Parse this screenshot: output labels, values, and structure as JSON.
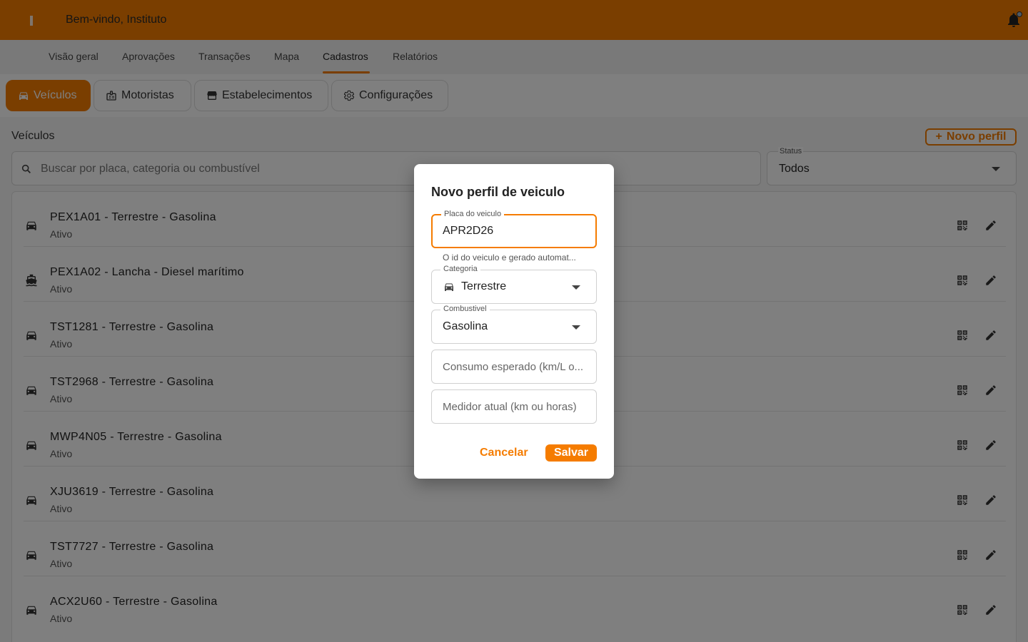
{
  "header": {
    "welcome": "Bem-vindo, Instituto",
    "menu_icon": "menu-icon",
    "notification_icon": "bell-icon"
  },
  "nav": {
    "tabs": [
      "Visão geral",
      "Aprovações",
      "Transações",
      "Mapa",
      "Cadastros",
      "Relatórios"
    ],
    "active": "Cadastros"
  },
  "chips": [
    {
      "label": "Veículos",
      "icon": "car-icon",
      "active": true
    },
    {
      "label": "Motoristas",
      "icon": "id-badge-icon",
      "active": false
    },
    {
      "label": "Estabelecimentos",
      "icon": "store-icon",
      "active": false
    },
    {
      "label": "Configurações",
      "icon": "gear-icon",
      "active": false
    }
  ],
  "section": {
    "title": "Veículos",
    "new_button": "Novo perfil"
  },
  "search": {
    "placeholder": "Buscar por placa, categoria ou combustível"
  },
  "status_filter": {
    "label": "Status",
    "value": "Todos"
  },
  "vehicles": [
    {
      "title": "PEX1A01 - Terrestre - Gasolina",
      "status": "Ativo",
      "icon": "car-icon"
    },
    {
      "title": "PEX1A02 - Lancha - Diesel marítimo",
      "status": "Ativo",
      "icon": "boat-icon"
    },
    {
      "title": "TST1281 - Terrestre - Gasolina",
      "status": "Ativo",
      "icon": "car-icon"
    },
    {
      "title": "TST2968 - Terrestre - Gasolina",
      "status": "Ativo",
      "icon": "car-icon"
    },
    {
      "title": "MWP4N05 - Terrestre - Gasolina",
      "status": "Ativo",
      "icon": "car-icon"
    },
    {
      "title": "XJU3619 - Terrestre - Gasolina",
      "status": "Ativo",
      "icon": "car-icon"
    },
    {
      "title": "TST7727 - Terrestre - Gasolina",
      "status": "Ativo",
      "icon": "car-icon"
    },
    {
      "title": "ACX2U60 - Terrestre - Gasolina",
      "status": "Ativo",
      "icon": "car-icon"
    }
  ],
  "dialog": {
    "title": "Novo perfil de veiculo",
    "plate_label": "Placa do veiculo",
    "plate_value": "APR2D26",
    "plate_helper": "O id do veiculo e gerado automat...",
    "category_label": "Categoria",
    "category_value": "Terrestre",
    "fuel_label": "Combustivel",
    "fuel_value": "Gasolina",
    "consumption_placeholder": "Consumo esperado (km/L o...",
    "meter_placeholder": "Medidor atual (km ou horas)",
    "cancel": "Cancelar",
    "save": "Salvar"
  },
  "colors": {
    "accent": "#f57c00",
    "overlay": "rgba(0,0,0,0.5)"
  }
}
